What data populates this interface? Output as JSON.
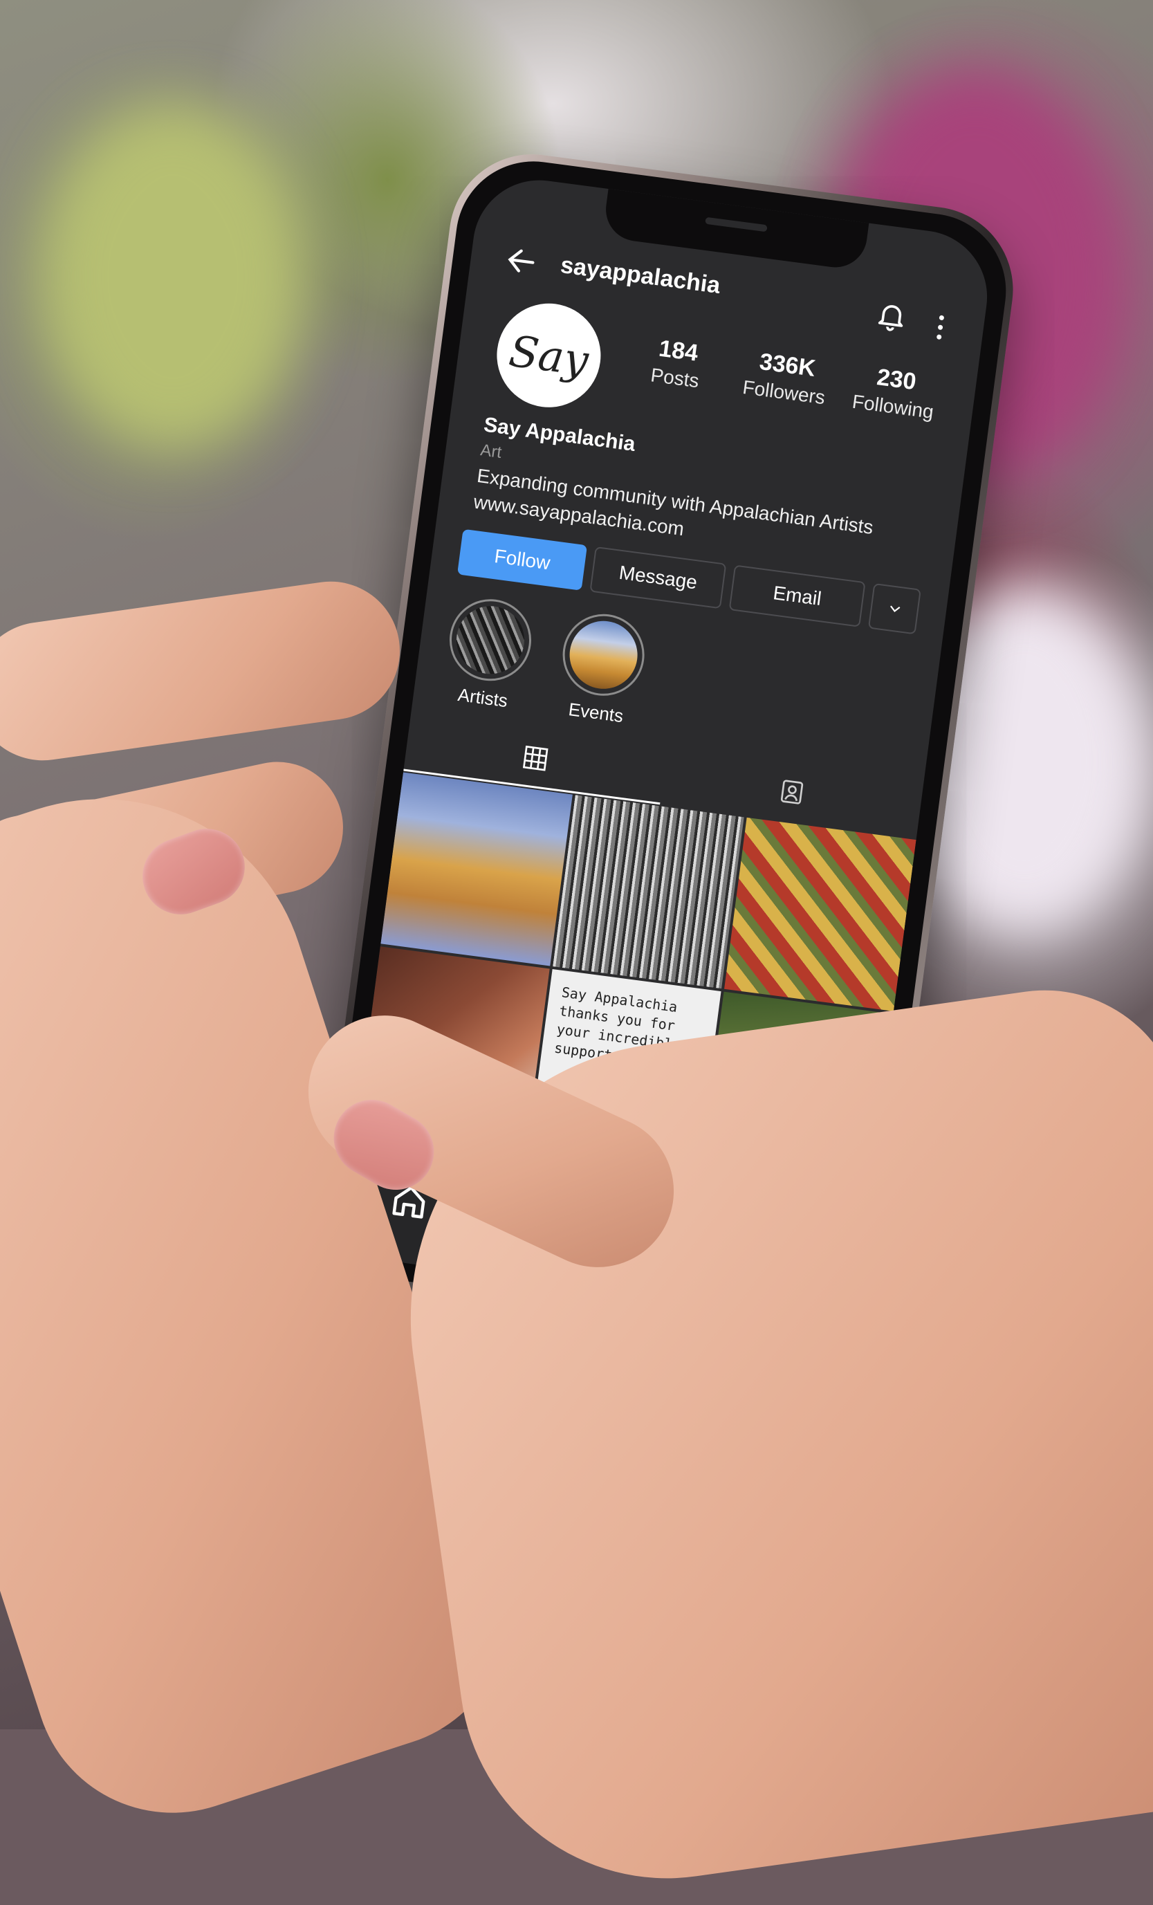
{
  "profile": {
    "username": "sayappalachia",
    "avatar_text": "Say",
    "name": "Say Appalachia",
    "category": "Art",
    "bio": "Expanding community with Appalachian Artists",
    "website": "www.sayappalachia.com"
  },
  "stats": [
    {
      "value": "184",
      "label": "Posts"
    },
    {
      "value": "336K",
      "label": "Followers"
    },
    {
      "value": "230",
      "label": "Following"
    }
  ],
  "buttons": {
    "follow": "Follow",
    "message": "Message",
    "email": "Email"
  },
  "highlights": [
    {
      "label": "Artists"
    },
    {
      "label": "Events"
    }
  ],
  "posts": {
    "text_post": "Say Appalachia thanks you for your incredible support."
  },
  "icons": {
    "back": "back-arrow-icon",
    "bell": "bell-icon",
    "more": "more-vertical-icon",
    "grid": "grid-icon",
    "tagged": "tagged-icon",
    "home": "home-icon",
    "search": "search-icon",
    "dropdown": "chevron-down-icon"
  },
  "colors": {
    "follow_button": "#4a9af5",
    "screen_bg": "#2b2b2d"
  }
}
